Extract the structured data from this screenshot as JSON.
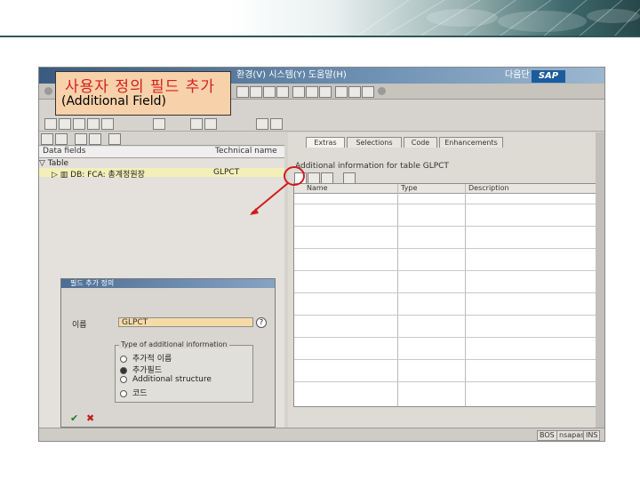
{
  "callout": {
    "title_ko": "사용자 정의 필드 추가",
    "title_en": "(Additional Field)"
  },
  "sap": {
    "logo": "SAP",
    "menu_text": "환경(V)   시스템(Y)   도움말(H)",
    "right_text": "다음단"
  },
  "left_pane": {
    "tree_col_object": "Data fields",
    "tree_col_technical": "Technical name",
    "tree_row_1": "▽ Table",
    "tree_row_2": "▷ ▥ DB: FCA: 총계정원장",
    "tree_row_2_tech": "GLPCT"
  },
  "dialog": {
    "title": "필드 추가 정의",
    "name_label": "이름",
    "name_value": "GLPCT",
    "help": "?",
    "group_title": "Type of additional information",
    "options": [
      "추가적 이름",
      "추가필드",
      "Additional structure",
      "코드"
    ],
    "selected_option": 1,
    "ok": "✔",
    "cancel": "✖"
  },
  "right_pane": {
    "tabs": [
      "Extras",
      "Selections",
      "Code",
      "Enhancements"
    ],
    "active_tab": 0,
    "info_text": "Additional information for table GLPCT",
    "columns": [
      "Name",
      "Type",
      "Description"
    ]
  },
  "status_bar": {
    "client": "BOS",
    "server": "nsapas",
    "mode": "INS"
  },
  "colors": {
    "callout_bg": "#f7d1a9",
    "callout_text": "#d42020",
    "arrow": "#d01b1b",
    "sap_blue": "#1b5c9c"
  }
}
